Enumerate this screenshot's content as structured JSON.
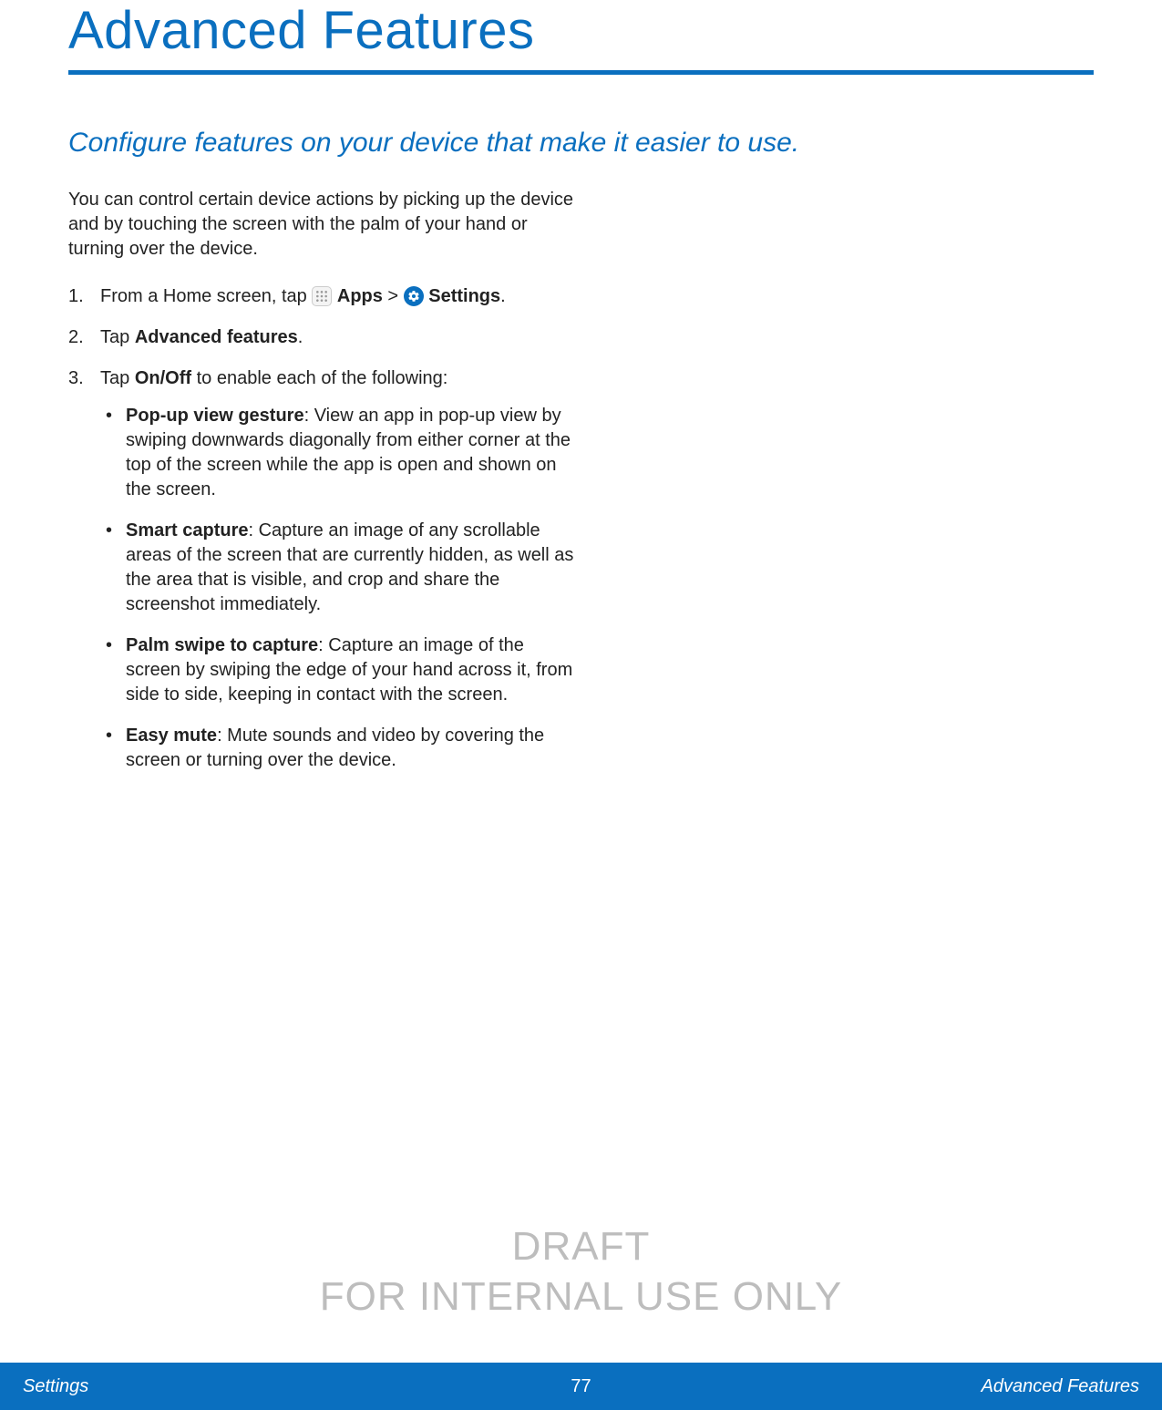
{
  "title": "Advanced Features",
  "subtitle": "Configure features on your device that make it easier to use.",
  "intro": "You can control certain device actions by picking up the device and by touching the screen with the palm of your hand or turning over the device.",
  "steps": {
    "s1": {
      "num": "1.",
      "prefix": "From a Home screen, tap ",
      "apps": "Apps",
      "sep": " > ",
      "settings": "Settings",
      "end": "."
    },
    "s2": {
      "num": "2.",
      "prefix": "Tap ",
      "bold": "Advanced features",
      "end": "."
    },
    "s3": {
      "num": "3.",
      "prefix": "Tap ",
      "bold": "On/Off",
      "suffix": " to enable each of the following:"
    }
  },
  "bullets": {
    "b1": {
      "title": "Pop-up view gesture",
      "desc": ": View an app in pop-up view by swiping downwards diagonally from either corner at the top of the screen while the app is open and shown on the screen."
    },
    "b2": {
      "title": "Smart capture",
      "desc": ": Capture an image of any scrollable areas of the screen that are currently hidden, as well as the area that is visible, and crop and share the screenshot immediately."
    },
    "b3": {
      "title": "Palm swipe to capture",
      "desc": ": Capture an image of the screen by swiping the edge of your hand across it, from side to side, keeping in contact with the screen."
    },
    "b4": {
      "title": "Easy mute",
      "desc": ": Mute sounds and video by covering the screen or turning over the device."
    }
  },
  "watermark": {
    "line1": "DRAFT",
    "line2": "FOR INTERNAL USE ONLY"
  },
  "footer": {
    "left": "Settings",
    "page": "77",
    "right": "Advanced Features"
  }
}
